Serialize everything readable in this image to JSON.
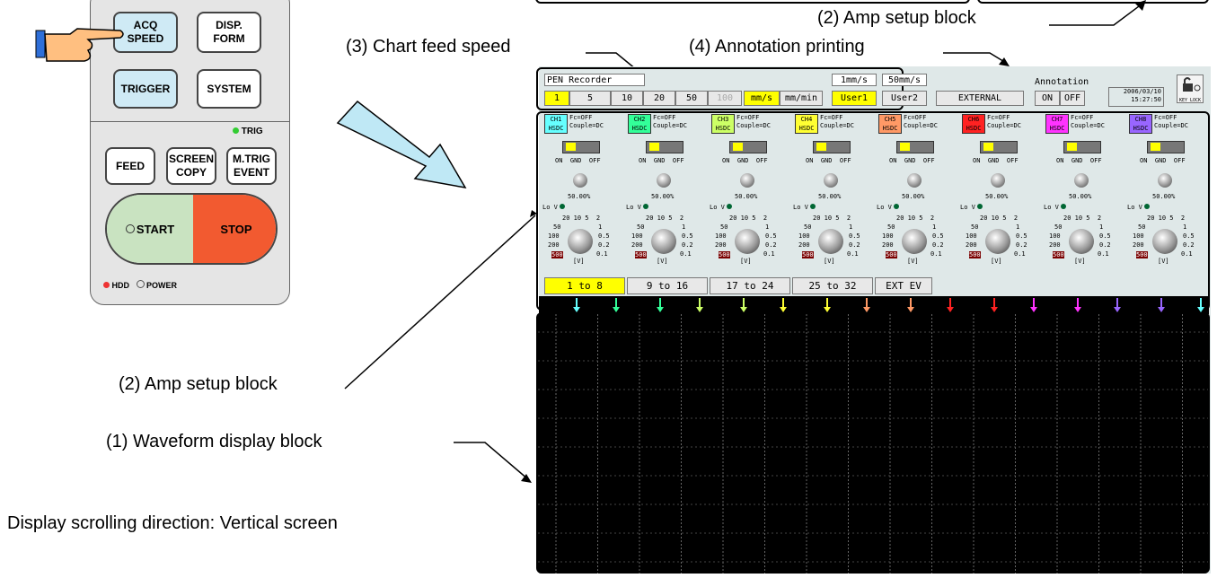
{
  "callouts": {
    "amp_setup_top": "(2) Amp setup block",
    "chart_feed": "(3) Chart feed speed",
    "annotation_printing": "(4) Annotation printing",
    "amp_setup_left": "(2) Amp setup block",
    "waveform_block": "(1) Waveform display block",
    "scroll_note": "Display scrolling direction: Vertical screen"
  },
  "panel": {
    "acq_speed": "ACQ SPEED",
    "disp_form": "DISP. FORM",
    "trigger": "TRIGGER",
    "system": "SYSTEM",
    "trig_led": "TRIG",
    "feed": "FEED",
    "screen_copy": "SCREEN COPY",
    "mtrig_event": "M.TRIG EVENT",
    "start": "START",
    "stop": "STOP",
    "hdd": "HDD",
    "power": "POWER",
    "colors": {
      "start_bg": "#c9e3c1",
      "stop_bg": "#f25a30",
      "key_blue": "#cfeaf5"
    }
  },
  "top_bar": {
    "title": "PEN Recorder",
    "speed1": "1mm/s",
    "speed2": "50mm/s",
    "speeds": [
      "1",
      "5",
      "10",
      "20",
      "50",
      "100"
    ],
    "unit_mms": "mm/s",
    "unit_mmmin": "mm/min",
    "user1": "User1",
    "user2": "User2",
    "external": "EXTERNAL",
    "annotation_label": "Annotation",
    "annotation_on": "ON",
    "annotation_off": "OFF",
    "date": "2006/03/10",
    "time": "15:27:50",
    "key_lock": "KEY LOCK"
  },
  "channels": [
    {
      "label": "CH1",
      "mode": "HSDC",
      "color": "#66ffff"
    },
    {
      "label": "CH2",
      "mode": "HSDC",
      "color": "#33ff99"
    },
    {
      "label": "CH3",
      "mode": "HSDC",
      "color": "#ccff66"
    },
    {
      "label": "CH4",
      "mode": "HSDC",
      "color": "#ffff33"
    },
    {
      "label": "CH5",
      "mode": "HSDC",
      "color": "#ff9966"
    },
    {
      "label": "CH6",
      "mode": "HSDC",
      "color": "#ff2222"
    },
    {
      "label": "CH7",
      "mode": "HSDC",
      "color": "#ff33ff"
    },
    {
      "label": "CH8",
      "mode": "HSDC",
      "color": "#9966ff"
    }
  ],
  "channel_common": {
    "fc": "Fc=OFF",
    "couple": "Couple=DC",
    "sw_labels": "ON  GND  OFF",
    "percent": "50.00%",
    "lov": "Lo V",
    "unit": "[V]",
    "scale_top": "20 10 5  2",
    "scale_l1": "50",
    "scale_l2": "100",
    "scale_l3": "200",
    "scale_l4": "500",
    "scale_r1": "1",
    "scale_r2": "0.5",
    "scale_r3": "0.2",
    "scale_r4": "0.1"
  },
  "ch_tabs": [
    "1 to 8",
    "9 to 16",
    "17 to 24",
    "25 to 32",
    "EXT EV"
  ]
}
